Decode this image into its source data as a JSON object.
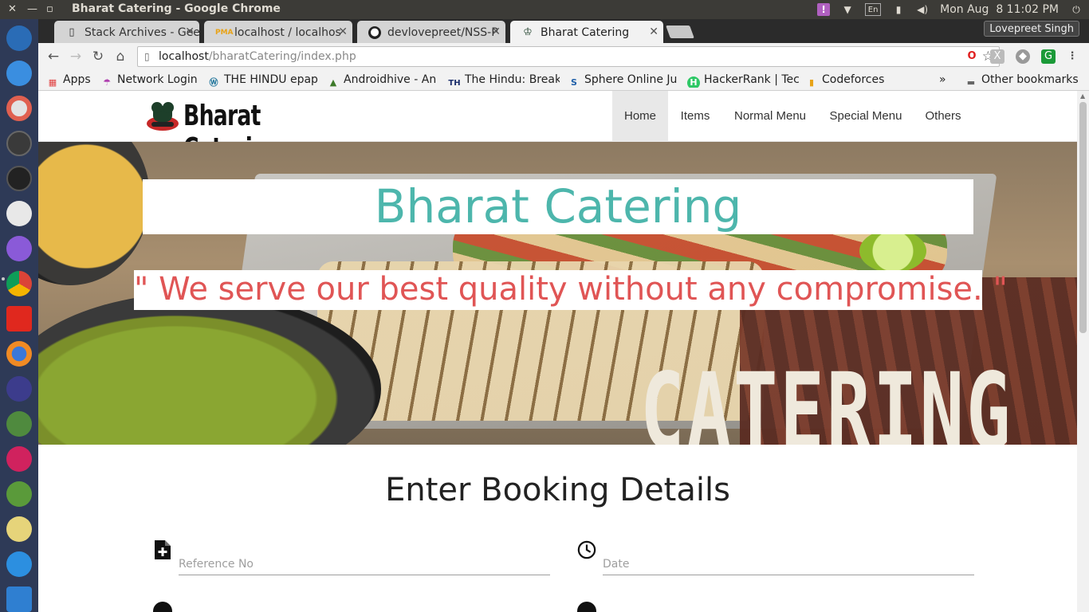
{
  "window": {
    "title": "Bharat Catering - Google Chrome"
  },
  "system_tray": {
    "clock": "Mon Aug  8 11:02 PM",
    "keyboard": "En"
  },
  "tabs": [
    {
      "label": "Stack Archives - Gee",
      "favicon": "page-icon"
    },
    {
      "label": "localhost / localhos",
      "favicon": "phpmyadmin-icon"
    },
    {
      "label": "devlovepreet/NSS-P",
      "favicon": "github-icon"
    },
    {
      "label": "Bharat Catering",
      "favicon": "chef-hat-icon"
    }
  ],
  "profile": {
    "name": "Lovepreet Singh"
  },
  "address_bar": {
    "host": "localhost",
    "path": "/bharatCatering/index.php"
  },
  "bookmarks": [
    {
      "label": "Apps",
      "icon": "apps-grid-icon"
    },
    {
      "label": "Network Login",
      "icon": "umbrella-icon"
    },
    {
      "label": "THE HINDU epap",
      "icon": "wordpress-icon"
    },
    {
      "label": "Androidhive - An",
      "icon": "androidhive-icon"
    },
    {
      "label": "The Hindu: Break",
      "icon": "th-icon"
    },
    {
      "label": "Sphere Online Ju",
      "icon": "spoj-icon"
    },
    {
      "label": "HackerRank | Tec",
      "icon": "hackerrank-icon"
    },
    {
      "label": "Codeforces",
      "icon": "codeforces-icon"
    }
  ],
  "bookmarks_overflow": "»",
  "other_bookmarks": "Other bookmarks",
  "site": {
    "brand": "Bharat Catering",
    "nav": [
      "Home",
      "Items",
      "Normal Menu",
      "Special Menu",
      "Others"
    ],
    "active_nav": "Home",
    "hero_title": "Bharat Catering",
    "hero_quote": "\" We serve our best quality without any compromise. \"",
    "hero_image_word": "CATERING",
    "booking_title": "Enter Booking Details",
    "fields": [
      {
        "placeholder": "Reference No",
        "icon": "add-document-icon"
      },
      {
        "placeholder": "Date",
        "icon": "clock-icon"
      }
    ]
  },
  "colors": {
    "hero_title": "#4db6ac",
    "hero_quote": "#e05555",
    "launcher_bg": "#2e3a57",
    "topbar_bg": "#3c3b37"
  }
}
